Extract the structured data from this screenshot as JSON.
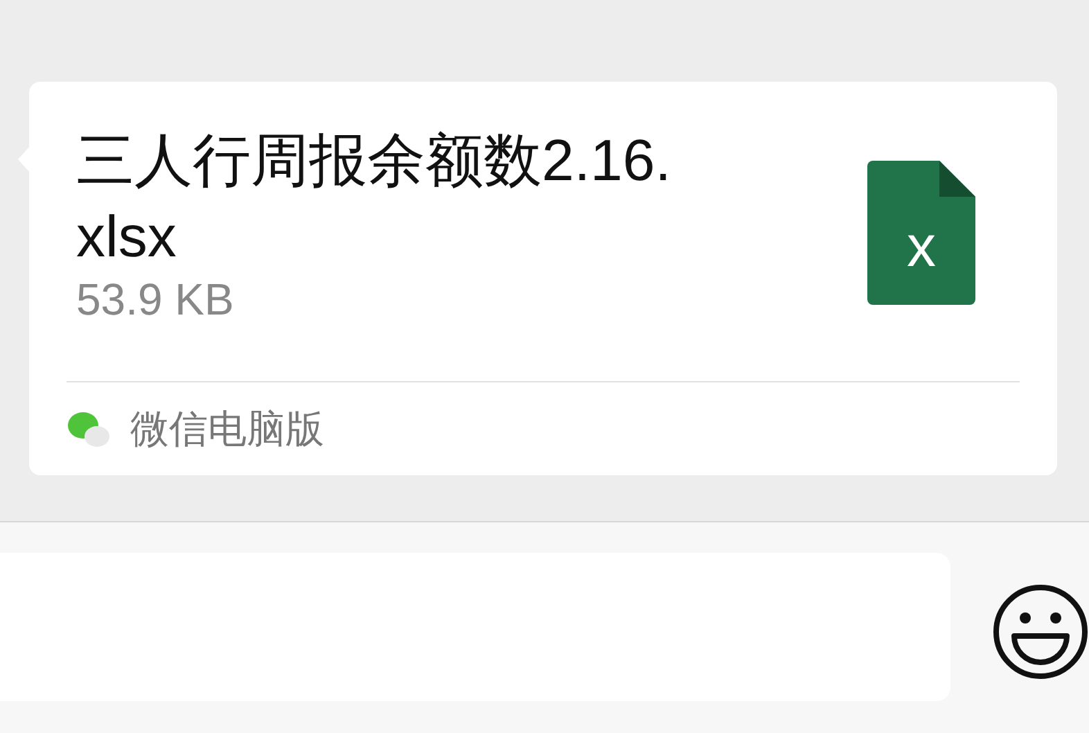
{
  "message": {
    "file_name": "三人行周报余额数2.16.xlsx",
    "file_size": "53.9 KB",
    "file_icon_letter": "x",
    "source": "微信电脑版"
  }
}
